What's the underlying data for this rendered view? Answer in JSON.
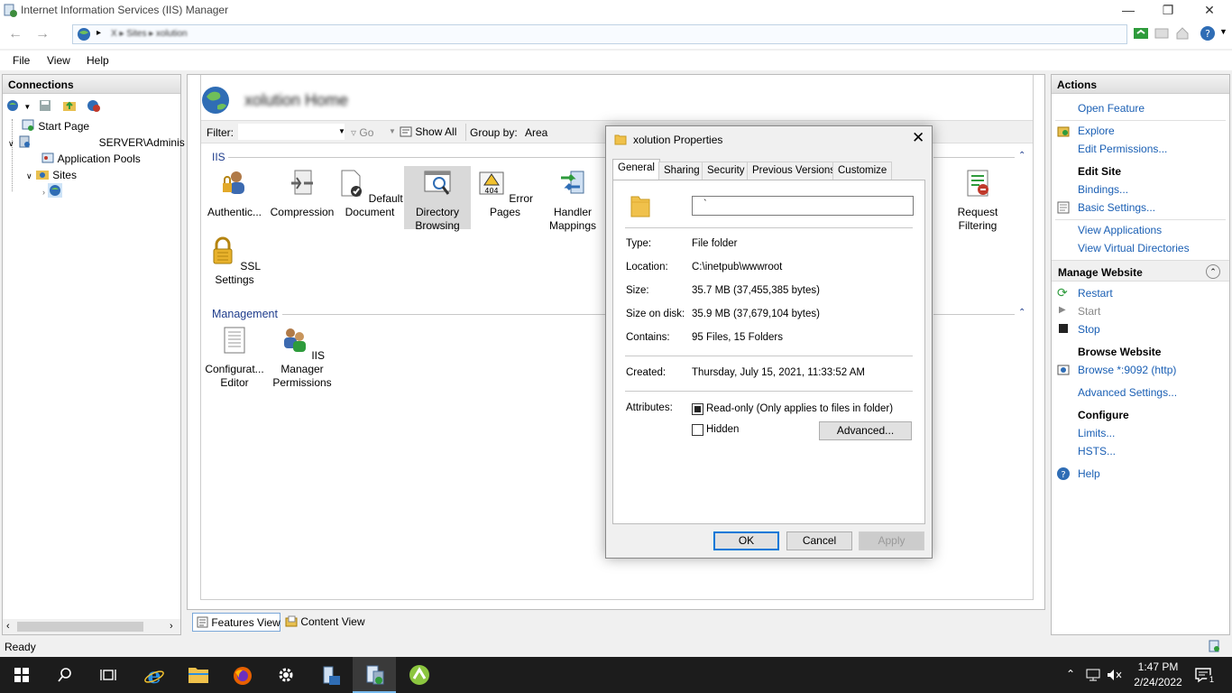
{
  "window": {
    "title": "Internet Information Services (IIS) Manager"
  },
  "address": {
    "path": "X ▸ Sites ▸ xolution"
  },
  "menu": [
    "File",
    "View",
    "Help"
  ],
  "connections": {
    "title": "Connections",
    "tree": [
      {
        "label": "Start Page"
      },
      {
        "label": "SERVER\\Adminis"
      },
      {
        "label": "Application Pools"
      },
      {
        "label": "Sites"
      },
      {
        "label": ""
      }
    ]
  },
  "center": {
    "page_title": "xolution Home",
    "filter_label": "Filter:",
    "go_label": "Go",
    "show_all_label": "Show All",
    "group_by_label": "Group by:",
    "group_by_value": "Area",
    "sections": [
      {
        "title": "IIS",
        "features": [
          {
            "label": "Authentic...",
            "icon": "authentication-icon"
          },
          {
            "label": "Compression",
            "icon": "compression-icon"
          },
          {
            "label": "Default Document",
            "icon": "default-document-icon"
          },
          {
            "label": "Directory Browsing",
            "icon": "directory-browsing-icon"
          },
          {
            "label": "Error Pages",
            "icon": "error-pages-icon"
          },
          {
            "label": "Handler Mappings",
            "icon": "handler-mappings-icon"
          },
          {
            "label": "Request Filtering",
            "icon": "request-filtering-icon"
          },
          {
            "label": "SSL Settings",
            "icon": "ssl-settings-icon"
          }
        ]
      },
      {
        "title": "Management",
        "features": [
          {
            "label": "Configurat... Editor",
            "icon": "configuration-editor-icon"
          },
          {
            "label": "IIS Manager Permissions",
            "icon": "iis-manager-permissions-icon"
          }
        ]
      }
    ],
    "views": {
      "features": "Features View",
      "content": "Content View"
    }
  },
  "actions": {
    "title": "Actions",
    "open_feature": "Open Feature",
    "explore": "Explore",
    "edit_permissions": "Edit Permissions...",
    "edit_site": "Edit Site",
    "bindings": "Bindings...",
    "basic_settings": "Basic Settings...",
    "view_applications": "View Applications",
    "view_virtual_directories": "View Virtual Directories",
    "manage_website": "Manage Website",
    "restart": "Restart",
    "start": "Start",
    "stop": "Stop",
    "browse_website": "Browse Website",
    "browse_link": "Browse *:9092 (http)",
    "advanced_settings": "Advanced Settings...",
    "configure": "Configure",
    "limits": "Limits...",
    "hsts": "HSTS...",
    "help": "Help"
  },
  "status": {
    "text": "Ready"
  },
  "dialog": {
    "title": "xolution Properties",
    "tabs": [
      "General",
      "Sharing",
      "Security",
      "Previous Versions",
      "Customize"
    ],
    "name_value": "`",
    "rows": [
      {
        "label": "Type:",
        "value": "File folder"
      },
      {
        "label": "Location:",
        "value": "C:\\inetpub\\wwwroot"
      },
      {
        "label": "Size:",
        "value": "35.7 MB (37,455,385 bytes)"
      },
      {
        "label": "Size on disk:",
        "value": "35.9 MB (37,679,104 bytes)"
      },
      {
        "label": "Contains:",
        "value": "95 Files, 15 Folders"
      }
    ],
    "created_label": "Created:",
    "created_value": "Thursday, July 15, 2021, 11:33:52 AM",
    "attributes_label": "Attributes:",
    "readonly_label": "Read-only (Only applies to files in folder)",
    "hidden_label": "Hidden",
    "advanced_btn": "Advanced...",
    "ok": "OK",
    "cancel": "Cancel",
    "apply": "Apply"
  },
  "taskbar": {
    "time": "1:47 PM",
    "date": "2/24/2022",
    "notif_count": "1"
  },
  "colors": {
    "accent": "#0078d7",
    "link": "#1a5fb4",
    "taskbar": "#1c1c1c"
  }
}
